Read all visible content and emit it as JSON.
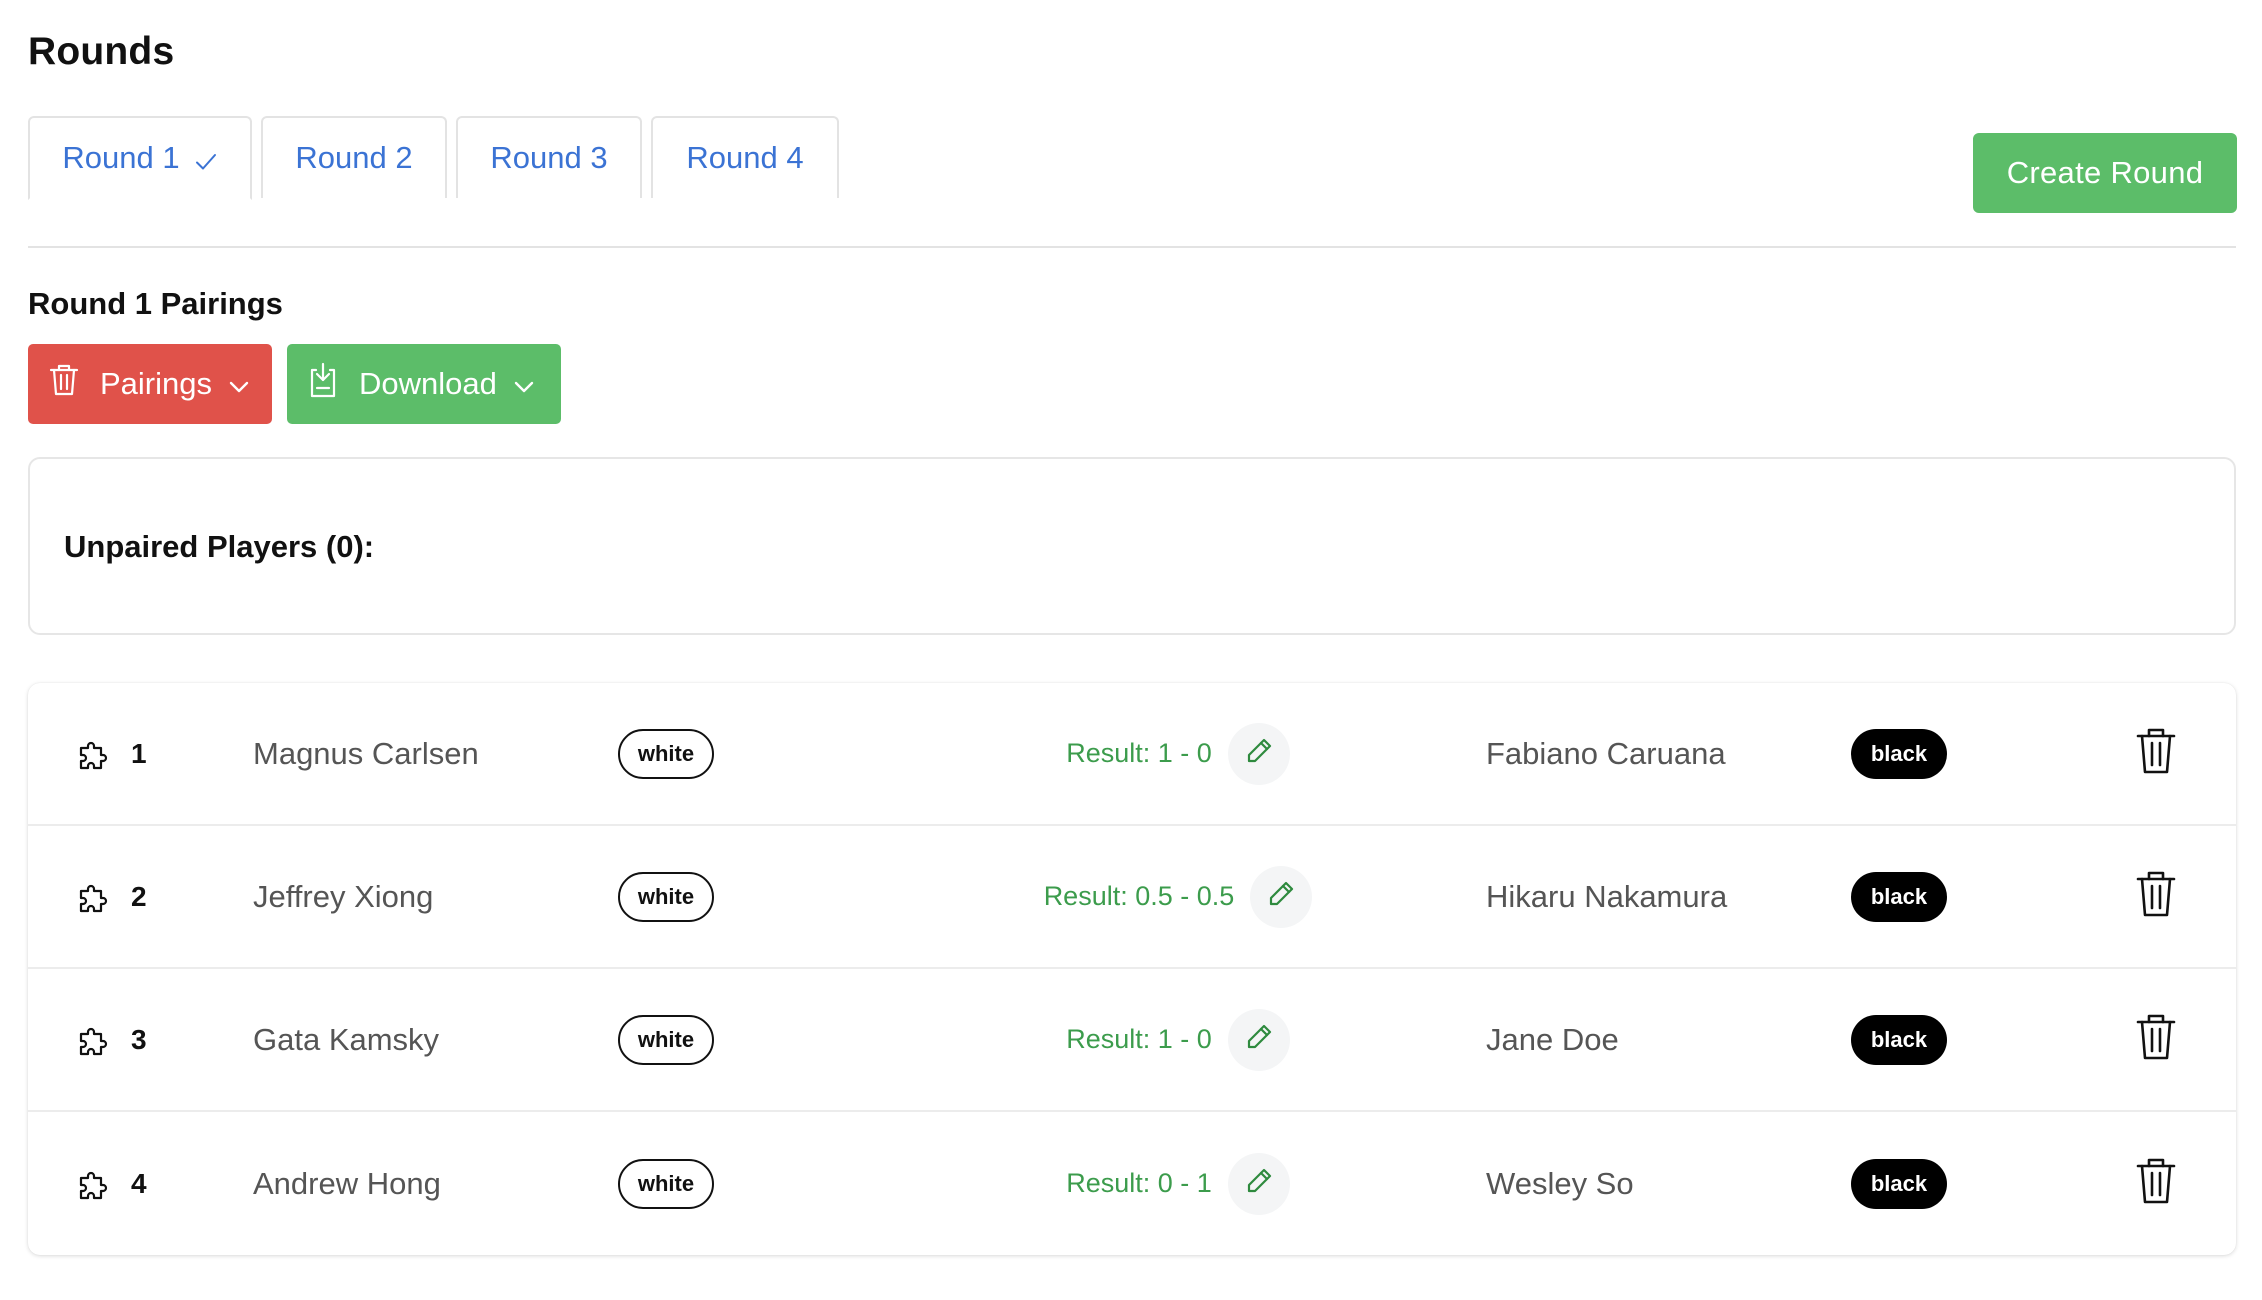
{
  "header": {
    "title": "Rounds"
  },
  "tabs": [
    {
      "label": "Round 1",
      "completed": true,
      "active": true
    },
    {
      "label": "Round 2",
      "completed": false,
      "active": false
    },
    {
      "label": "Round 3",
      "completed": false,
      "active": false
    },
    {
      "label": "Round 4",
      "completed": false,
      "active": false
    }
  ],
  "actions": {
    "create_round": "Create Round"
  },
  "pairings_section": {
    "title": "Round 1 Pairings",
    "pairings_button": "Pairings",
    "download_button": "Download"
  },
  "unpaired": {
    "label": "Unpaired Players (0):"
  },
  "pairings": [
    {
      "board": "1",
      "white_player": "Magnus Carlsen",
      "white_badge": "white",
      "result": "Result: 1 - 0",
      "black_player": "Fabiano Caruana",
      "black_badge": "black"
    },
    {
      "board": "2",
      "white_player": "Jeffrey Xiong",
      "white_badge": "white",
      "result": "Result: 0.5 - 0.5",
      "black_player": "Hikaru Nakamura",
      "black_badge": "black"
    },
    {
      "board": "3",
      "white_player": "Gata Kamsky",
      "white_badge": "white",
      "result": "Result: 1 - 0",
      "black_player": "Jane Doe",
      "black_badge": "black"
    },
    {
      "board": "4",
      "white_player": "Andrew Hong",
      "white_badge": "white",
      "result": "Result: 0 - 1",
      "black_player": "Wesley So",
      "black_badge": "black"
    }
  ],
  "icons": {
    "tab_check": "check-icon",
    "pairings_button": "trash-icon",
    "download_button": "download-icon",
    "dropdown": "chevron-down-icon",
    "row_leading": "puzzle-icon",
    "edit_result": "pencil-icon",
    "delete_pairing": "trash-icon"
  },
  "colors": {
    "tab_text": "#3b73d4",
    "create_round": "#5cbd69",
    "pairings_button": "#e0524a",
    "download_button": "#5cbd69",
    "result_text": "#3c9c4c"
  }
}
